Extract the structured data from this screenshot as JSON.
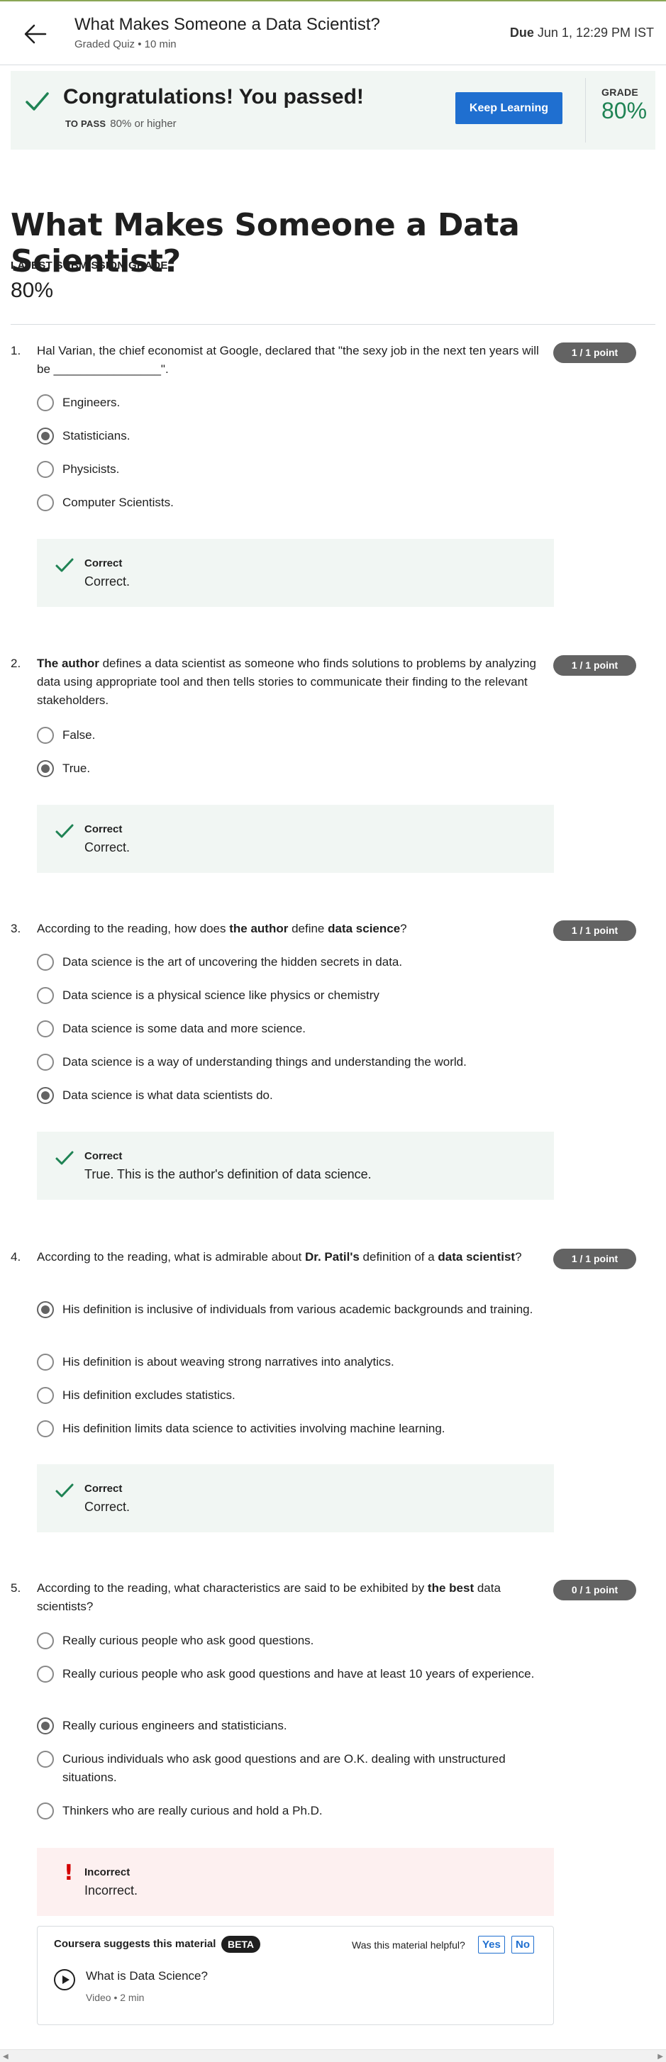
{
  "header": {
    "title": "What Makes Someone a Data Scientist?",
    "subtitle": "Graded Quiz • 10 min",
    "due_label": "Due",
    "due_value": "Jun 1, 12:29 PM IST"
  },
  "banner": {
    "title": "Congratulations! You passed!",
    "to_pass_label": "TO PASS",
    "to_pass_value": "80% or higher",
    "button": "Keep Learning",
    "grade_label": "GRADE",
    "grade_value": "80%"
  },
  "page": {
    "title": "What Makes Someone a Data Scientist?",
    "latest_label": "LATEST SUBMISSION GRADE",
    "latest_value": "80%"
  },
  "questions": [
    {
      "num": "1.",
      "pre": "Hal Varian, the chief economist at Google, declared that \"the sexy job in the next ten years will be ________________\".",
      "points": "1 / 1 point",
      "options": [
        "Engineers.",
        "Statisticians.",
        "Physicists.",
        "Computer Scientists."
      ],
      "selected": 1,
      "feedback_title": "Correct",
      "feedback_text": "Correct."
    },
    {
      "num": "2.",
      "bold1": "The author",
      "rest1": " defines a data scientist as someone who finds solutions to problems by analyzing data using appropriate tool and then tells stories to communicate their finding to the relevant stakeholders.",
      "points": "1 / 1 point",
      "options": [
        "False.",
        "True."
      ],
      "selected": 1,
      "feedback_title": "Correct",
      "feedback_text": "Correct."
    },
    {
      "num": "3.",
      "pre": "According to the reading, how does ",
      "bold1": "the author",
      "mid": " define ",
      "bold2": "data science",
      "post": "?",
      "points": "1 / 1 point",
      "options": [
        "Data science is the art of uncovering the hidden secrets in data.",
        "Data science is a physical science like physics or chemistry",
        "Data science is some data and more science.",
        "Data science is a way of understanding things and understanding the world.",
        "Data science is what data scientists do."
      ],
      "selected": 4,
      "feedback_title": "Correct",
      "feedback_text": "True. This is the author's definition of data science."
    },
    {
      "num": "4.",
      "pre": "According to the reading, what is admirable about ",
      "bold1": "Dr. Patil's",
      "mid": " definition of a ",
      "bold2": "data scientist",
      "post": "?",
      "points": "1 / 1 point",
      "options": [
        "His definition is inclusive of individuals from various academic backgrounds and training.",
        "His definition is about weaving strong narratives into analytics.",
        "His definition excludes statistics.",
        "His definition limits data science to activities involving machine learning."
      ],
      "selected": 0,
      "feedback_title": "Correct",
      "feedback_text": "Correct."
    },
    {
      "num": "5.",
      "pre": "According to the reading, what characteristics are said to be exhibited by ",
      "bold1": "the best",
      "post": " data scientists?",
      "points": "0 / 1 point",
      "options": [
        "Really curious people who ask good questions.",
        "Really curious people who ask good questions and have at least 10 years of experience.",
        "Really curious engineers and statisticians.",
        "Curious individuals who ask good questions and are O.K. dealing with unstructured situations.",
        "Thinkers who are really curious and hold a Ph.D."
      ],
      "selected": 2,
      "feedback_title": "Incorrect",
      "feedback_text": "Incorrect."
    }
  ],
  "suggestion": {
    "title": "Coursera suggests this material",
    "badge": "BETA",
    "helpful": "Was this material helpful?",
    "yes": "Yes",
    "no": "No",
    "item_title": "What is Data Science?",
    "item_meta": "Video • 2 min"
  },
  "colors": {
    "accent_blue": "#1f6fd0",
    "success_green": "#1f8354",
    "error_red": "#d30001",
    "pill_gray": "#636363"
  }
}
